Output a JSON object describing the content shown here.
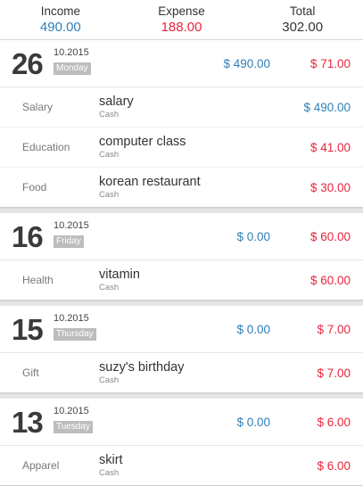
{
  "summary": {
    "income_label": "Income",
    "income_value": "490.00",
    "expense_label": "Expense",
    "expense_value": "188.00",
    "total_label": "Total",
    "total_value": "302.00"
  },
  "days": [
    {
      "day": "26",
      "month_year": "10.2015",
      "weekday": "Monday",
      "income": "$ 490.00",
      "expense": "$ 71.00",
      "entries": [
        {
          "category": "Salary",
          "title": "salary",
          "account": "Cash",
          "amount": "$ 490.00",
          "type": "income"
        },
        {
          "category": "Education",
          "title": "computer class",
          "account": "Cash",
          "amount": "$ 41.00",
          "type": "expense"
        },
        {
          "category": "Food",
          "title": "korean restaurant",
          "account": "Cash",
          "amount": "$ 30.00",
          "type": "expense"
        }
      ]
    },
    {
      "day": "16",
      "month_year": "10.2015",
      "weekday": "Friday",
      "income": "$ 0.00",
      "expense": "$ 60.00",
      "entries": [
        {
          "category": "Health",
          "title": "vitamin",
          "account": "Cash",
          "amount": "$ 60.00",
          "type": "expense"
        }
      ]
    },
    {
      "day": "15",
      "month_year": "10.2015",
      "weekday": "Thursday",
      "income": "$ 0.00",
      "expense": "$ 7.00",
      "entries": [
        {
          "category": "Gift",
          "title": "suzy's birthday",
          "account": "Cash",
          "amount": "$ 7.00",
          "type": "expense"
        }
      ]
    },
    {
      "day": "13",
      "month_year": "10.2015",
      "weekday": "Tuesday",
      "income": "$ 0.00",
      "expense": "$ 6.00",
      "entries": [
        {
          "category": "Apparel",
          "title": "skirt",
          "account": "Cash",
          "amount": "$ 6.00",
          "type": "expense"
        }
      ]
    }
  ],
  "colors": {
    "income": "#2f7fb8",
    "expense": "#e8263b"
  }
}
